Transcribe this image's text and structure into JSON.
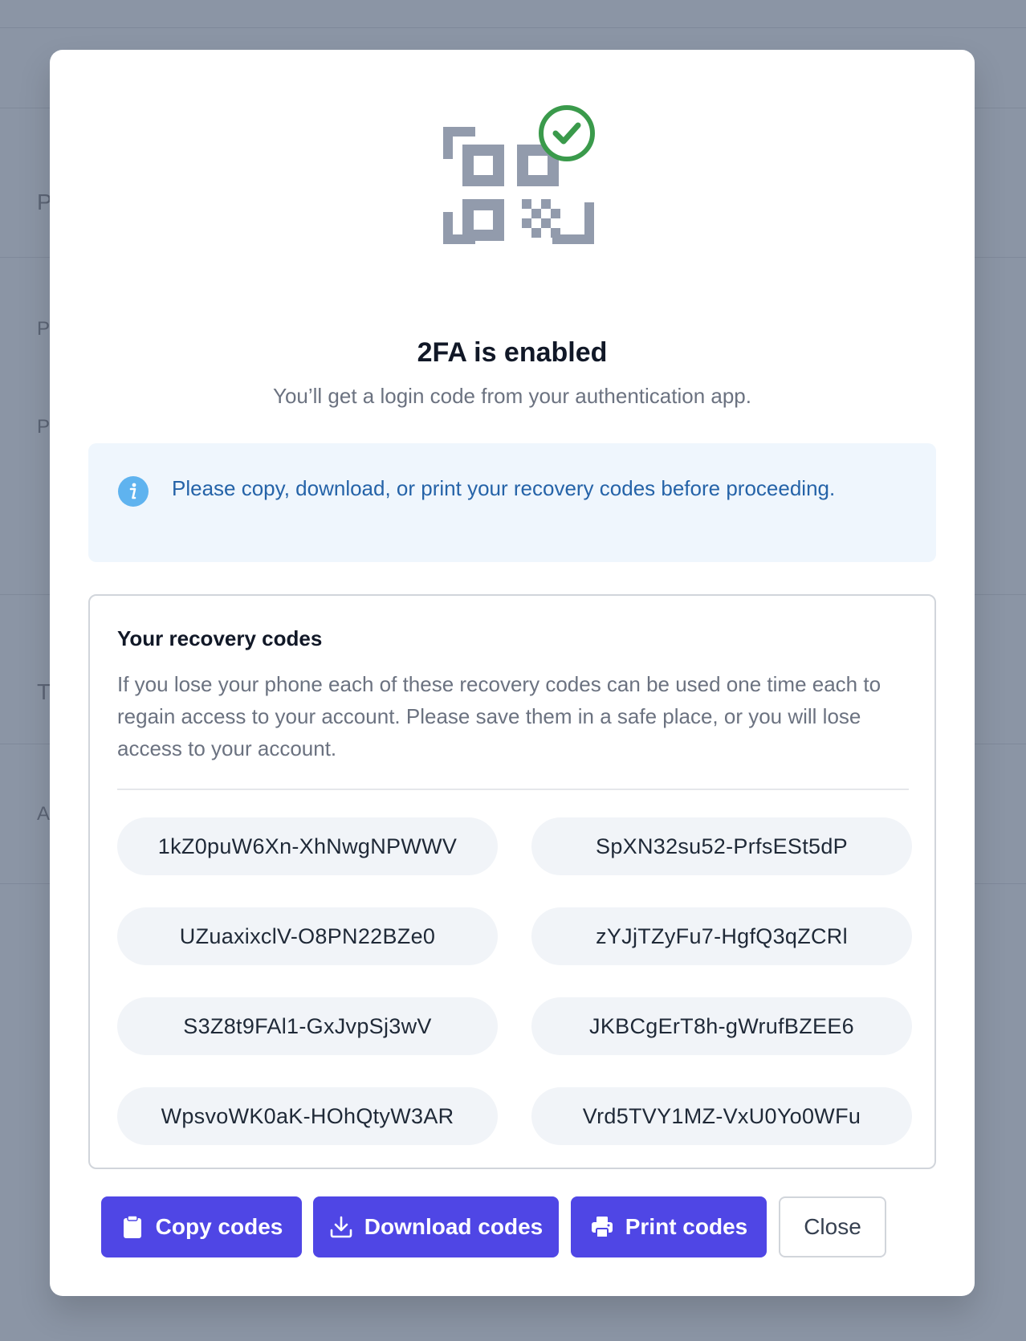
{
  "background": {
    "letters": [
      "P",
      "P",
      "P",
      "T",
      "A"
    ]
  },
  "modal": {
    "hero_icon": "qr-code-check-icon",
    "title": "2FA is enabled",
    "subtitle": "You’ll get a login code from your authentication app.",
    "info": {
      "icon": "info-icon",
      "text": "Please copy, download, or print your recovery codes before proceeding."
    },
    "codes": {
      "title": "Your recovery codes",
      "description": "If you lose your phone each of these recovery codes can be used one time each to regain access to your account. Please save them in a safe place, or you will lose access to your account.",
      "list": [
        "1kZ0puW6Xn-XhNwgNPWWV",
        "SpXN32su52-PrfsESt5dP",
        "UZuaxixclV-O8PN22BZe0",
        "zYJjTZyFu7-HgfQ3qZCRl",
        "S3Z8t9FAl1-GxJvpSj3wV",
        "JKBCgErT8h-gWrufBZEE6",
        "WpsvoWK0aK-HOhQtyW3AR",
        "Vrd5TVY1MZ-VxU0Yo0WFu"
      ]
    },
    "actions": {
      "copy_label": "Copy codes",
      "download_label": "Download codes",
      "print_label": "Print codes",
      "close_label": "Close"
    },
    "colors": {
      "primary": "#4f46e5",
      "success": "#3a9a4b",
      "info": "#2563a8",
      "info_bg": "#eff6fd"
    }
  }
}
